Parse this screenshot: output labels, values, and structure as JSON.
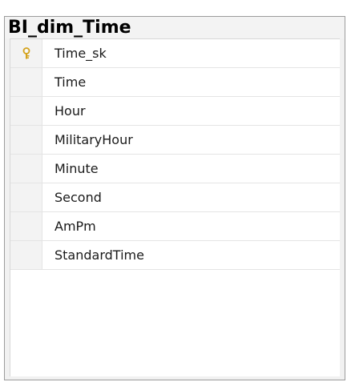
{
  "table": {
    "title": "BI_dim_Time",
    "columns": [
      {
        "name": "Time_sk",
        "primary_key": true,
        "icon": "key-icon"
      },
      {
        "name": "Time",
        "primary_key": false
      },
      {
        "name": "Hour",
        "primary_key": false
      },
      {
        "name": "MilitaryHour",
        "primary_key": false
      },
      {
        "name": "Minute",
        "primary_key": false
      },
      {
        "name": "Second",
        "primary_key": false
      },
      {
        "name": "AmPm",
        "primary_key": false
      },
      {
        "name": "StandardTime",
        "primary_key": false
      }
    ]
  },
  "colors": {
    "title_bar": "#f3f3f3",
    "border": "#9c9c9c",
    "key_gold": "#d4a21a"
  }
}
